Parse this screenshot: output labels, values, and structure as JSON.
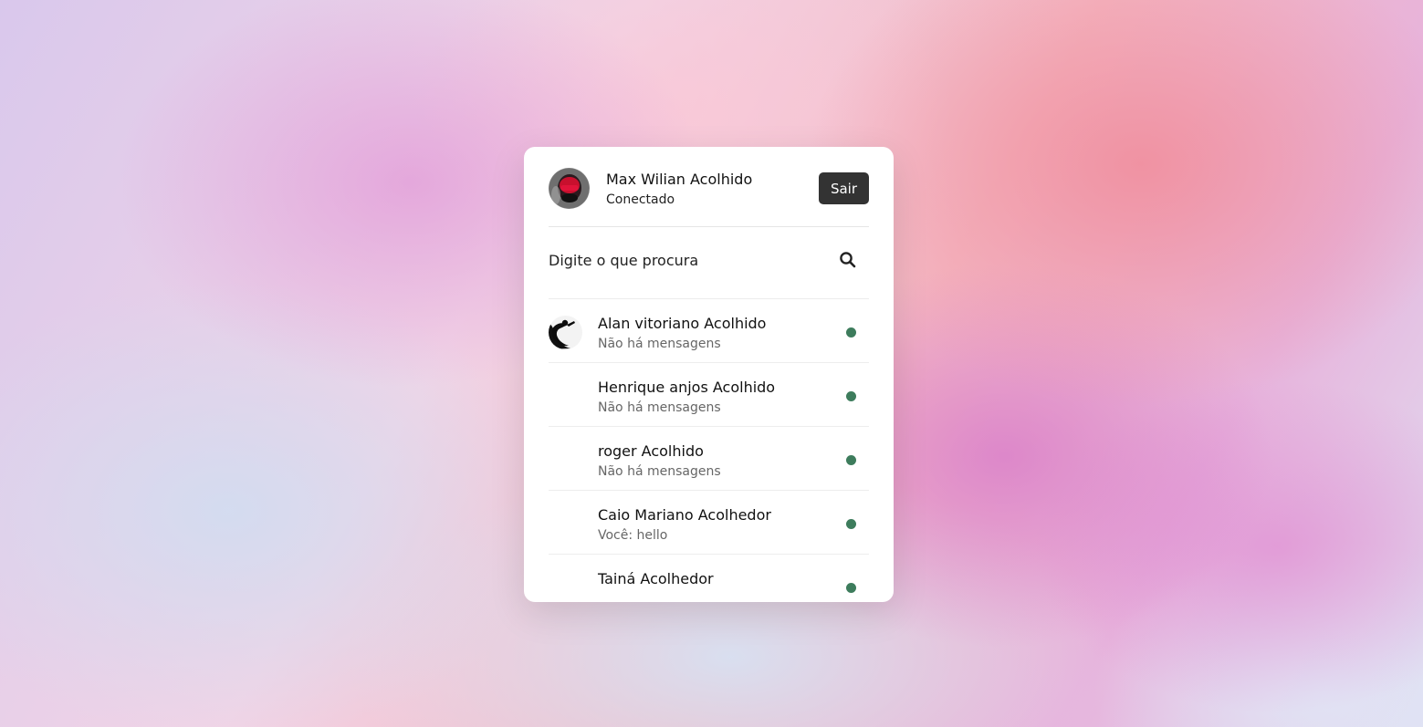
{
  "user": {
    "name": "Max Wilian Acolhido",
    "status": "Conectado",
    "avatar_icon": "user-photo-avatar"
  },
  "header": {
    "logout_label": "Sair"
  },
  "search": {
    "placeholder": "Digite o que procura",
    "icon": "search-icon"
  },
  "contacts": [
    {
      "name": "Alan vitoriano Acolhido",
      "message": "Não há mensagens",
      "has_avatar": true,
      "online": true
    },
    {
      "name": "Henrique anjos Acolhido",
      "message": "Não há mensagens",
      "has_avatar": false,
      "online": true
    },
    {
      "name": "roger Acolhido",
      "message": "Não há mensagens",
      "has_avatar": false,
      "online": true
    },
    {
      "name": "Caio Mariano Acolhedor",
      "message": "Você: hello",
      "has_avatar": false,
      "online": true
    },
    {
      "name": "Tainá Acolhedor",
      "message": "",
      "has_avatar": false,
      "online": true
    }
  ],
  "colors": {
    "online": "#3d7c5c",
    "button": "#333333"
  }
}
